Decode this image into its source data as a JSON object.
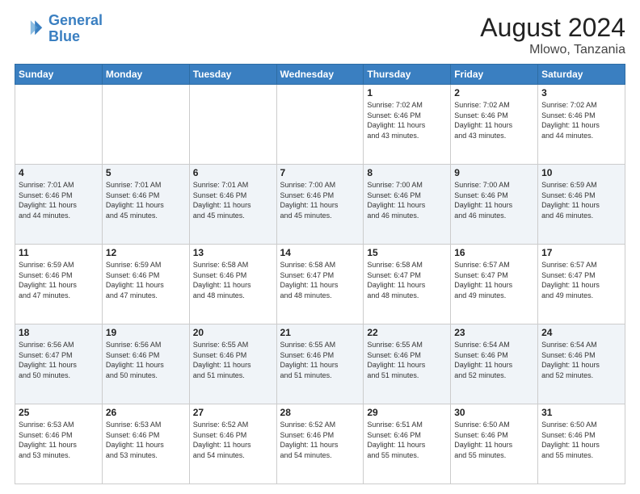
{
  "logo": {
    "line1": "General",
    "line2": "Blue"
  },
  "title": "August 2024",
  "subtitle": "Mlowo, Tanzania",
  "weekdays": [
    "Sunday",
    "Monday",
    "Tuesday",
    "Wednesday",
    "Thursday",
    "Friday",
    "Saturday"
  ],
  "weeks": [
    [
      {
        "day": "",
        "info": ""
      },
      {
        "day": "",
        "info": ""
      },
      {
        "day": "",
        "info": ""
      },
      {
        "day": "",
        "info": ""
      },
      {
        "day": "1",
        "info": "Sunrise: 7:02 AM\nSunset: 6:46 PM\nDaylight: 11 hours\nand 43 minutes."
      },
      {
        "day": "2",
        "info": "Sunrise: 7:02 AM\nSunset: 6:46 PM\nDaylight: 11 hours\nand 43 minutes."
      },
      {
        "day": "3",
        "info": "Sunrise: 7:02 AM\nSunset: 6:46 PM\nDaylight: 11 hours\nand 44 minutes."
      }
    ],
    [
      {
        "day": "4",
        "info": "Sunrise: 7:01 AM\nSunset: 6:46 PM\nDaylight: 11 hours\nand 44 minutes."
      },
      {
        "day": "5",
        "info": "Sunrise: 7:01 AM\nSunset: 6:46 PM\nDaylight: 11 hours\nand 45 minutes."
      },
      {
        "day": "6",
        "info": "Sunrise: 7:01 AM\nSunset: 6:46 PM\nDaylight: 11 hours\nand 45 minutes."
      },
      {
        "day": "7",
        "info": "Sunrise: 7:00 AM\nSunset: 6:46 PM\nDaylight: 11 hours\nand 45 minutes."
      },
      {
        "day": "8",
        "info": "Sunrise: 7:00 AM\nSunset: 6:46 PM\nDaylight: 11 hours\nand 46 minutes."
      },
      {
        "day": "9",
        "info": "Sunrise: 7:00 AM\nSunset: 6:46 PM\nDaylight: 11 hours\nand 46 minutes."
      },
      {
        "day": "10",
        "info": "Sunrise: 6:59 AM\nSunset: 6:46 PM\nDaylight: 11 hours\nand 46 minutes."
      }
    ],
    [
      {
        "day": "11",
        "info": "Sunrise: 6:59 AM\nSunset: 6:46 PM\nDaylight: 11 hours\nand 47 minutes."
      },
      {
        "day": "12",
        "info": "Sunrise: 6:59 AM\nSunset: 6:46 PM\nDaylight: 11 hours\nand 47 minutes."
      },
      {
        "day": "13",
        "info": "Sunrise: 6:58 AM\nSunset: 6:46 PM\nDaylight: 11 hours\nand 48 minutes."
      },
      {
        "day": "14",
        "info": "Sunrise: 6:58 AM\nSunset: 6:47 PM\nDaylight: 11 hours\nand 48 minutes."
      },
      {
        "day": "15",
        "info": "Sunrise: 6:58 AM\nSunset: 6:47 PM\nDaylight: 11 hours\nand 48 minutes."
      },
      {
        "day": "16",
        "info": "Sunrise: 6:57 AM\nSunset: 6:47 PM\nDaylight: 11 hours\nand 49 minutes."
      },
      {
        "day": "17",
        "info": "Sunrise: 6:57 AM\nSunset: 6:47 PM\nDaylight: 11 hours\nand 49 minutes."
      }
    ],
    [
      {
        "day": "18",
        "info": "Sunrise: 6:56 AM\nSunset: 6:47 PM\nDaylight: 11 hours\nand 50 minutes."
      },
      {
        "day": "19",
        "info": "Sunrise: 6:56 AM\nSunset: 6:46 PM\nDaylight: 11 hours\nand 50 minutes."
      },
      {
        "day": "20",
        "info": "Sunrise: 6:55 AM\nSunset: 6:46 PM\nDaylight: 11 hours\nand 51 minutes."
      },
      {
        "day": "21",
        "info": "Sunrise: 6:55 AM\nSunset: 6:46 PM\nDaylight: 11 hours\nand 51 minutes."
      },
      {
        "day": "22",
        "info": "Sunrise: 6:55 AM\nSunset: 6:46 PM\nDaylight: 11 hours\nand 51 minutes."
      },
      {
        "day": "23",
        "info": "Sunrise: 6:54 AM\nSunset: 6:46 PM\nDaylight: 11 hours\nand 52 minutes."
      },
      {
        "day": "24",
        "info": "Sunrise: 6:54 AM\nSunset: 6:46 PM\nDaylight: 11 hours\nand 52 minutes."
      }
    ],
    [
      {
        "day": "25",
        "info": "Sunrise: 6:53 AM\nSunset: 6:46 PM\nDaylight: 11 hours\nand 53 minutes."
      },
      {
        "day": "26",
        "info": "Sunrise: 6:53 AM\nSunset: 6:46 PM\nDaylight: 11 hours\nand 53 minutes."
      },
      {
        "day": "27",
        "info": "Sunrise: 6:52 AM\nSunset: 6:46 PM\nDaylight: 11 hours\nand 54 minutes."
      },
      {
        "day": "28",
        "info": "Sunrise: 6:52 AM\nSunset: 6:46 PM\nDaylight: 11 hours\nand 54 minutes."
      },
      {
        "day": "29",
        "info": "Sunrise: 6:51 AM\nSunset: 6:46 PM\nDaylight: 11 hours\nand 55 minutes."
      },
      {
        "day": "30",
        "info": "Sunrise: 6:50 AM\nSunset: 6:46 PM\nDaylight: 11 hours\nand 55 minutes."
      },
      {
        "day": "31",
        "info": "Sunrise: 6:50 AM\nSunset: 6:46 PM\nDaylight: 11 hours\nand 55 minutes."
      }
    ]
  ]
}
